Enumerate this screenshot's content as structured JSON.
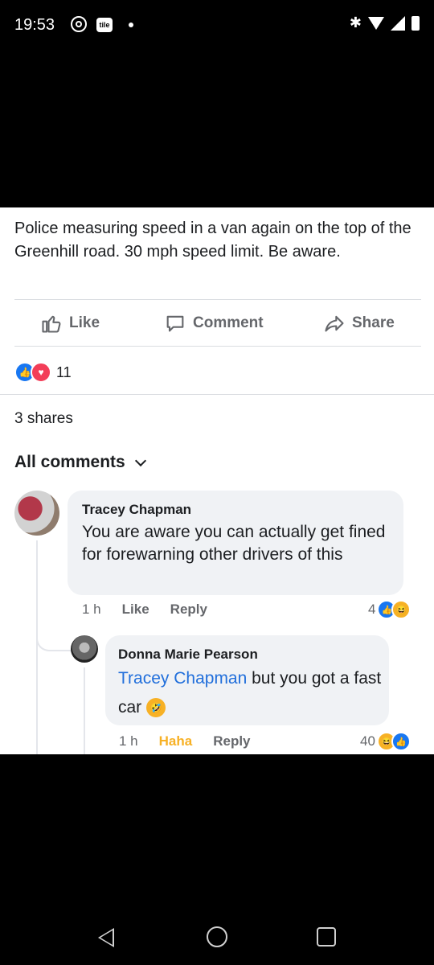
{
  "status_bar": {
    "time": "19:53",
    "tile_label": "tile"
  },
  "post": {
    "text": "Police measuring speed in a van again on the top of the Greenhill road. 30 mph speed limit. Be aware.",
    "actions": {
      "like": "Like",
      "comment": "Comment",
      "share": "Share"
    },
    "reaction_count": "11",
    "shares": "3 shares"
  },
  "comments_header": "All comments",
  "comments": [
    {
      "author": "Tracey Chapman",
      "text": "You are aware you can actually get fined for forewarning other drivers of this",
      "time": "1 h",
      "like": "Like",
      "reply": "Reply",
      "reaction_count": "4"
    },
    {
      "author": "Donna Marie Pearson",
      "mention": "Tracey Chapman",
      "text_after_mention": " but you got a fast car",
      "time": "1 h",
      "reaction_label": "Haha",
      "reply": "Reply",
      "reaction_count": "40"
    }
  ],
  "colors": {
    "accent": "#1877f2",
    "love": "#f33e58",
    "haha": "#f7b125",
    "mention": "#216fdb"
  }
}
